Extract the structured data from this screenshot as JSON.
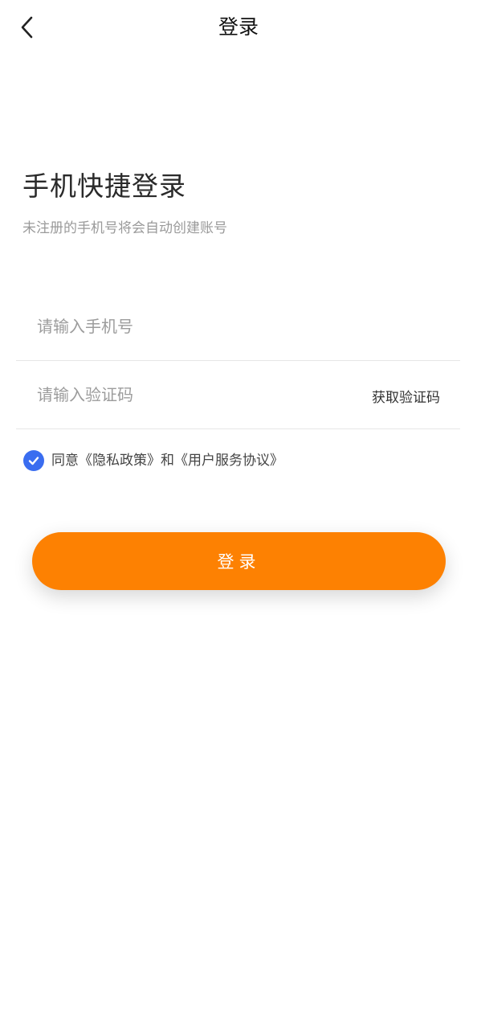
{
  "header": {
    "back_icon": "chevron-left-icon",
    "title": "登录"
  },
  "headline": "手机快捷登录",
  "subhead": "未注册的手机号将会自动创建账号",
  "phone_field": {
    "value": "",
    "placeholder": "请输入手机号"
  },
  "code_field": {
    "value": "",
    "placeholder": "请输入验证码",
    "get_code_label": "获取验证码"
  },
  "agreement": {
    "checked": true,
    "checkbox_icon": "checkmark-icon",
    "prefix": "同意",
    "privacy_link": "《隐私政策》",
    "connector": "和",
    "service_link": "《用户服务协议》"
  },
  "login_button": {
    "label": "登录"
  },
  "colors": {
    "accent": "#fd8102",
    "checkbox": "#3a6df0",
    "divider": "#e6e6e6"
  }
}
